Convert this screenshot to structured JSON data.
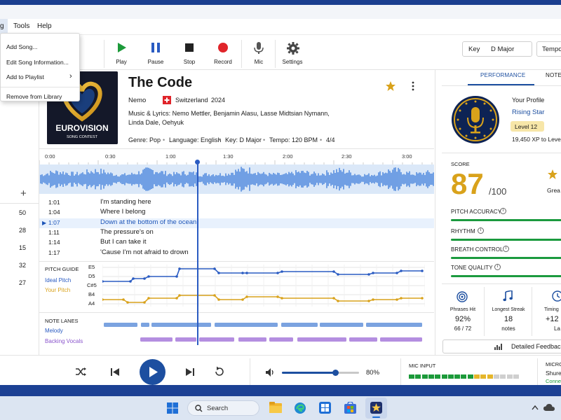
{
  "menu": {
    "partial_first": "g",
    "tools": "Tools",
    "help": "Help"
  },
  "dropdown": {
    "add_song": "Add Song...",
    "edit_info": "Edit Song Information...",
    "add_playlist": "Add to Playlist",
    "add_playlist_arrow": "›",
    "remove": "Remove from Library"
  },
  "toolbar": {
    "play": "Play",
    "pause": "Pause",
    "stop": "Stop",
    "record": "Record",
    "mic": "Mic",
    "settings": "Settings",
    "key_label": "Key",
    "key_value": "D Major",
    "tempo_partial": "Tempo"
  },
  "left_strip": {
    "add": "+",
    "values": [
      "50",
      "28",
      "15",
      "32",
      "27"
    ]
  },
  "song": {
    "title": "The Code",
    "artist": "Nemo",
    "country": "Switzerland",
    "year": "2024",
    "credits_line1": "Music & Lyrics: Nemo Mettler, Benjamin Alasu, Lasse Midtsian Nymann,",
    "credits_line2": "Linda Dale, Oehyuk",
    "genre": "Genre: Pop",
    "language": "Language: English",
    "key": "Key: D Major",
    "tempo": "Tempo: 120 BPM",
    "time_sig": "4/4",
    "sep": "•",
    "album_text1": "EUROVISION",
    "album_text2": "SONG CONTEST"
  },
  "timeline": {
    "ticks": [
      "0:00",
      "0:30",
      "1:00",
      "1:30",
      "2:00",
      "2:30",
      "3:00"
    ]
  },
  "lyrics": [
    {
      "time": "1:01",
      "text": "I'm standing here",
      "active": false
    },
    {
      "time": "1:04",
      "text": "Where I belong",
      "active": false
    },
    {
      "time": "1:07",
      "text": "Down at the bottom of the ocean",
      "active": true
    },
    {
      "time": "1:11",
      "text": "The pressure's on",
      "active": false
    },
    {
      "time": "1:14",
      "text": "But I can take it",
      "active": false
    },
    {
      "time": "1:17",
      "text": "'Cause I'm not afraid to drown",
      "active": false
    }
  ],
  "pitch_guide": {
    "title": "PITCH GUIDE",
    "ideal": "Ideal Pitch",
    "yours": "Your Pitch",
    "notes": [
      "E5",
      "D5",
      "C#5",
      "B4",
      "A4"
    ],
    "ideal_color": "#2a5bc2",
    "your_color": "#d9a21b"
  },
  "note_lanes": {
    "title": "NOTE LANES",
    "melody": "Melody",
    "backing": "Backing Vocals",
    "melody_color": "#7ba3e0",
    "backing_color": "#b48ee0"
  },
  "panel": {
    "tab_performance": "PERFORMANCE",
    "tab_notes_partial": "NOTES",
    "profile_title": "Your Profile",
    "profile_rank": "Rising Star",
    "level": "Level 12",
    "xp": "19,450 XP to Leve",
    "score_label": "SCORE",
    "score": "87",
    "score_max": "/100",
    "great_partial": "Grea",
    "skills": [
      {
        "label": "PITCH ACCURACY",
        "value": 0.82
      },
      {
        "label": "RHYTHM",
        "value": 0.88
      },
      {
        "label": "BREATH CONTROL",
        "value": 0.84
      },
      {
        "label": "TONE QUALITY",
        "value": 0.86
      }
    ],
    "stats": {
      "phrases_label": "Phrases Hit",
      "phrases_pct": "92%",
      "phrases_count": "66 / 72",
      "streak_label": "Longest Streak",
      "streak_val": "18",
      "streak_unit": "notes",
      "timing_label": "Timing",
      "timing_val": "+12",
      "timing_unit": "La"
    },
    "feedback_btn": "Detailed Feedback"
  },
  "transport": {
    "volume_pct": "80%",
    "volume_level": 0.8,
    "mic_input_label": "MIC INPUT",
    "micro_partial": "MICRO",
    "mic_model_partial": "Shure",
    "mic_status_partial": "Conne"
  },
  "taskbar": {
    "search": "Search"
  }
}
